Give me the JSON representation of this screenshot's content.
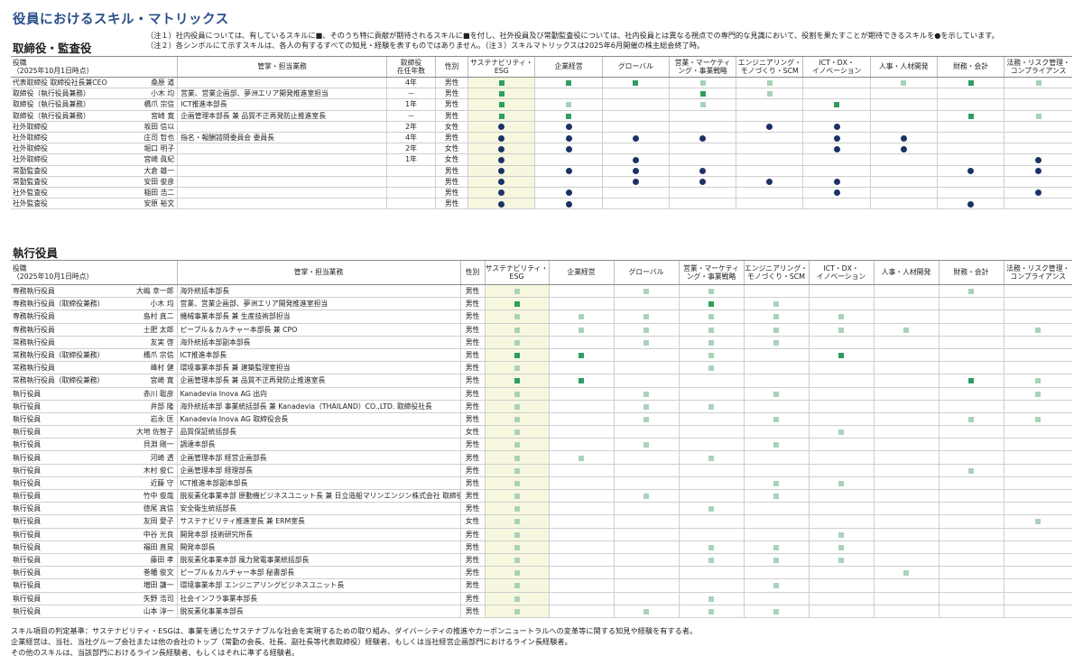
{
  "page_title": "役員におけるスキル・マトリックス",
  "board_section_title": "取締役・監査役",
  "exec_section_title": "執行役員",
  "notes": [
    "（注１）社内役員については、有しているスキルに■、そのうち特に貢献が期待されるスキルに■を付し、社外役員及び常勤監査役については、社内役員とは異なる視点での専門的な見識において、役割を果たすことが期待できるスキルを●を示しています。",
    "（注２）各シンボルにて示すスキルは、各人の有するすべての知見・経験を表すものではありません。（注３）スキルマトリックスは2025年6月開催の株主総会終了時。"
  ],
  "colors": {
    "title": "#2a4f8a",
    "light_square": "#a9d2b9",
    "dark_square": "#2f9e5f",
    "dot": "#1c3266",
    "esg_highlight": "#f7f7df"
  },
  "icons": {
    "L": "light-green-square-icon",
    "D": "dark-green-square-icon",
    "O": "navy-dot-icon"
  },
  "board_table": {
    "headers": {
      "role": "役職\n（2025年10月1日時点）",
      "duty": "管掌・担当業務",
      "tenure": "取締役\n在任年数",
      "gender": "性別"
    },
    "skills": [
      "サステナビリティ・\nESG",
      "企業経営",
      "グローバル",
      "営業・マーケティ\nング・事業戦略",
      "エンジニアリング・\nモノづくり・SCM",
      "ICT・DX・\nイノベーション",
      "人事・人材開発",
      "財務・会計",
      "法務・リスク管理・\nコンプライアンス"
    ],
    "rows": [
      {
        "role": "代表取締役 取締役社長兼CEO",
        "name": "桑原 道",
        "duty": "",
        "tenure": "4年",
        "gender": "男性",
        "skills": [
          "D",
          "D",
          "D",
          "L",
          "L",
          "",
          "L",
          "D",
          "L"
        ]
      },
      {
        "role": "取締役（執行役員兼務）",
        "name": "小木 均",
        "duty": "営業、営業企画部、夢洲エリア開発推進室担当",
        "tenure": "－",
        "gender": "男性",
        "skills": [
          "D",
          "",
          "",
          "D",
          "L",
          "",
          "",
          "",
          ""
        ]
      },
      {
        "role": "取締役（執行役員兼務）",
        "name": "橋爪 宗信",
        "duty": "ICT推進本部長",
        "tenure": "1年",
        "gender": "男性",
        "skills": [
          "D",
          "L",
          "",
          "L",
          "",
          "D",
          "",
          "",
          ""
        ]
      },
      {
        "role": "取締役（執行役員兼務）",
        "name": "宮崎 寛",
        "duty": "企画管理本部長 兼 品質不正再発防止推進室長",
        "tenure": "－",
        "gender": "男性",
        "skills": [
          "D",
          "D",
          "",
          "",
          "",
          "",
          "",
          "D",
          "L"
        ]
      },
      {
        "role": "社外取締役",
        "name": "坂田 信以",
        "duty": "",
        "tenure": "2年",
        "gender": "女性",
        "skills": [
          "O",
          "O",
          "",
          "",
          "O",
          "O",
          "",
          "",
          ""
        ]
      },
      {
        "role": "社外取締役",
        "name": "庄司 哲也",
        "duty": "指名・報酬諮問委員会 委員長",
        "tenure": "4年",
        "gender": "男性",
        "skills": [
          "O",
          "O",
          "O",
          "O",
          "",
          "O",
          "O",
          "",
          ""
        ]
      },
      {
        "role": "社外取締役",
        "name": "堀口 明子",
        "duty": "",
        "tenure": "2年",
        "gender": "女性",
        "skills": [
          "O",
          "O",
          "",
          "",
          "",
          "O",
          "O",
          "",
          ""
        ]
      },
      {
        "role": "社外取締役",
        "name": "宮崎 眞紀",
        "duty": "",
        "tenure": "1年",
        "gender": "女性",
        "skills": [
          "O",
          "",
          "O",
          "",
          "",
          "",
          "",
          "",
          "O"
        ]
      },
      {
        "role": "常勤監査役",
        "name": "大倉 雄一",
        "duty": "",
        "tenure": "",
        "gender": "男性",
        "skills": [
          "O",
          "O",
          "O",
          "O",
          "",
          "",
          "",
          "O",
          "O"
        ]
      },
      {
        "role": "常勤監査役",
        "name": "安田 俊彦",
        "duty": "",
        "tenure": "",
        "gender": "男性",
        "skills": [
          "O",
          "",
          "O",
          "O",
          "O",
          "O",
          "",
          "",
          ""
        ]
      },
      {
        "role": "社外監査役",
        "name": "稲田 浩二",
        "duty": "",
        "tenure": "",
        "gender": "男性",
        "skills": [
          "O",
          "O",
          "",
          "",
          "",
          "O",
          "",
          "",
          "O"
        ]
      },
      {
        "role": "社外監査役",
        "name": "安原 裕文",
        "duty": "",
        "tenure": "",
        "gender": "男性",
        "skills": [
          "O",
          "O",
          "",
          "",
          "",
          "",
          "",
          "O",
          ""
        ]
      }
    ]
  },
  "exec_table": {
    "headers": {
      "role": "役職\n（2025年10月1日時点）",
      "duty": "管掌・担当業務",
      "gender": "性別"
    },
    "skills": [
      "サステナビリティ・\nESG",
      "企業経営",
      "グローバル",
      "営業・マーケティ\nング・事業戦略",
      "エンジニアリング・\nモノづくり・SCM",
      "ICT・DX・\nイノベーション",
      "人事・人材開発",
      "財務・会計",
      "法務・リスク管理・\nコンプライアンス"
    ],
    "rows": [
      {
        "role": "専務執行役員",
        "name": "大嶋 幸一郎",
        "duty": "海外統括本部長",
        "gender": "男性",
        "skills": [
          "L",
          "",
          "L",
          "L",
          "",
          "",
          "",
          "L",
          ""
        ]
      },
      {
        "role": "専務執行役員（取締役兼務）",
        "name": "小木 均",
        "duty": "営業、営業企画部、夢洲エリア開発推進室担当",
        "gender": "男性",
        "skills": [
          "D",
          "",
          "",
          "D",
          "L",
          "",
          "",
          "",
          ""
        ]
      },
      {
        "role": "専務執行役員",
        "name": "島村 真二",
        "duty": "機械事業本部長 兼 生産技術部担当",
        "gender": "男性",
        "skills": [
          "L",
          "L",
          "L",
          "L",
          "L",
          "L",
          "",
          "",
          ""
        ]
      },
      {
        "role": "専務執行役員",
        "name": "土肥 太郎",
        "duty": "ピープル＆カルチャー本部長 兼 CPO",
        "gender": "男性",
        "skills": [
          "L",
          "L",
          "L",
          "L",
          "L",
          "L",
          "L",
          "",
          "L"
        ]
      },
      {
        "role": "常務執行役員",
        "name": "友実 啓",
        "duty": "海外統括本部副本部長",
        "gender": "男性",
        "skills": [
          "L",
          "",
          "L",
          "L",
          "L",
          "",
          "",
          "",
          ""
        ]
      },
      {
        "role": "常務執行役員（取締役兼務）",
        "name": "橋爪 宗信",
        "duty": "ICT推進本部長",
        "gender": "男性",
        "skills": [
          "D",
          "D",
          "",
          "L",
          "",
          "D",
          "",
          "",
          ""
        ]
      },
      {
        "role": "常務執行役員",
        "name": "峰村 健",
        "duty": "環境事業本部長 兼 建築監理室担当",
        "gender": "男性",
        "skills": [
          "L",
          "",
          "",
          "L",
          "",
          "",
          "",
          "",
          ""
        ]
      },
      {
        "role": "常務執行役員（取締役兼務）",
        "name": "宮崎 寛",
        "duty": "企画管理本部長 兼 品質不正再発防止推進室長",
        "gender": "男性",
        "skills": [
          "D",
          "D",
          "",
          "",
          "",
          "",
          "",
          "D",
          "L"
        ]
      },
      {
        "role": "執行役員",
        "name": "赤川 聡彦",
        "duty": "Kanadevia Inova AG 出向",
        "gender": "男性",
        "skills": [
          "L",
          "",
          "L",
          "",
          "L",
          "",
          "",
          "",
          "L"
        ]
      },
      {
        "role": "執行役員",
        "name": "井部 隆",
        "duty": "海外統括本部 事業統括部長 兼 Kanadevia（THAILAND）CO.,LTD. 取締役社長",
        "gender": "男性",
        "skills": [
          "L",
          "",
          "L",
          "L",
          "",
          "",
          "",
          "",
          ""
        ]
      },
      {
        "role": "執行役員",
        "name": "岩永 匡",
        "duty": "Kanadevia Inova AG 取締役会長",
        "gender": "男性",
        "skills": [
          "L",
          "",
          "L",
          "",
          "L",
          "",
          "",
          "L",
          "L"
        ]
      },
      {
        "role": "執行役員",
        "name": "大地 佐智子",
        "duty": "品質保証統括部長",
        "gender": "女性",
        "skills": [
          "L",
          "",
          "",
          "",
          "",
          "L",
          "",
          "",
          ""
        ]
      },
      {
        "role": "執行役員",
        "name": "貝淵 剛一",
        "duty": "調達本部長",
        "gender": "男性",
        "skills": [
          "L",
          "",
          "L",
          "",
          "L",
          "",
          "",
          "",
          ""
        ]
      },
      {
        "role": "執行役員",
        "name": "河崎 透",
        "duty": "企画管理本部 経営企画部長",
        "gender": "男性",
        "skills": [
          "L",
          "L",
          "",
          "L",
          "",
          "",
          "",
          "",
          ""
        ]
      },
      {
        "role": "執行役員",
        "name": "木村 俊仁",
        "duty": "企画管理本部 経理部長",
        "gender": "男性",
        "skills": [
          "L",
          "",
          "",
          "",
          "",
          "",
          "",
          "L",
          ""
        ]
      },
      {
        "role": "執行役員",
        "name": "近藤 守",
        "duty": "ICT推進本部副本部長",
        "gender": "男性",
        "skills": [
          "L",
          "",
          "",
          "",
          "L",
          "L",
          "",
          "",
          ""
        ]
      },
      {
        "role": "執行役員",
        "name": "竹中 俊哉",
        "duty": "脱炭素化事業本部 原動機ビジネスユニット長 兼 日立造船マリンエンジン株式会社 取締役社長",
        "gender": "男性",
        "skills": [
          "L",
          "",
          "L",
          "",
          "L",
          "",
          "",
          "",
          ""
        ]
      },
      {
        "role": "執行役員",
        "name": "徳尾 真信",
        "duty": "安全衛生統括部長",
        "gender": "男性",
        "skills": [
          "L",
          "",
          "",
          "L",
          "",
          "",
          "",
          "",
          ""
        ]
      },
      {
        "role": "執行役員",
        "name": "友岡 愛子",
        "duty": "サステナビリティ推進室長 兼 ERM室長",
        "gender": "女性",
        "skills": [
          "L",
          "",
          "",
          "",
          "",
          "",
          "",
          "",
          "L"
        ]
      },
      {
        "role": "執行役員",
        "name": "中谷 光良",
        "duty": "開発本部 技術研究所長",
        "gender": "男性",
        "skills": [
          "L",
          "",
          "",
          "",
          "",
          "L",
          "",
          "",
          ""
        ]
      },
      {
        "role": "執行役員",
        "name": "福田 直晃",
        "duty": "開発本部長",
        "gender": "男性",
        "skills": [
          "L",
          "",
          "",
          "L",
          "L",
          "L",
          "",
          "",
          ""
        ]
      },
      {
        "role": "執行役員",
        "name": "藤田 孝",
        "duty": "脱炭素化事業本部 風力発電事業統括部長",
        "gender": "男性",
        "skills": [
          "L",
          "",
          "",
          "L",
          "L",
          "L",
          "",
          "",
          ""
        ]
      },
      {
        "role": "執行役員",
        "name": "巻幡 俊文",
        "duty": "ピープル＆カルチャー本部 秘書部長",
        "gender": "男性",
        "skills": [
          "L",
          "",
          "",
          "",
          "",
          "",
          "L",
          "",
          ""
        ]
      },
      {
        "role": "執行役員",
        "name": "増田 謙一",
        "duty": "環境事業本部 エンジニアリングビジネスユニット長",
        "gender": "男性",
        "skills": [
          "L",
          "",
          "",
          "",
          "L",
          "",
          "",
          "",
          ""
        ]
      },
      {
        "role": "執行役員",
        "name": "矢野 浩司",
        "duty": "社会インフラ事業本部長",
        "gender": "男性",
        "skills": [
          "L",
          "",
          "",
          "L",
          "",
          "",
          "",
          "",
          ""
        ]
      },
      {
        "role": "執行役員",
        "name": "山本 淳一",
        "duty": "脱炭素化事業本部長",
        "gender": "男性",
        "skills": [
          "L",
          "",
          "L",
          "L",
          "L",
          "",
          "",
          "",
          ""
        ]
      }
    ]
  },
  "footnotes": [
    "スキル項目の判定基準：サステナビリティ・ESGは、事業を通じたサステナブルな社会を実現するための取り組み、ダイバーシティの推進やカーボンニュートラルへの変革等に関する知見や経験を有する者。",
    "企業経営は、当社、当社グループ会社または他の会社のトップ（常勤の会長、社長、副社長等代表取締役）経験者、もしくは当社経営企画部門におけるライン長経験者。",
    "その他のスキルは、当該部門におけるライン長経験者、もしくはそれに準ずる経験者。"
  ]
}
